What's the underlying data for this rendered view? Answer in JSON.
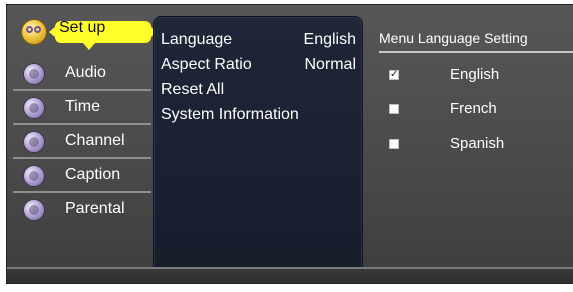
{
  "menu": {
    "items": [
      {
        "label": "Set up",
        "icon": "setup-icon",
        "selected": true
      },
      {
        "label": "Audio",
        "icon": "audio-icon"
      },
      {
        "label": "Time",
        "icon": "time-icon"
      },
      {
        "label": "Channel",
        "icon": "channel-icon"
      },
      {
        "label": "Caption",
        "icon": "caption-icon"
      },
      {
        "label": "Parental",
        "icon": "parental-icon"
      }
    ]
  },
  "center": {
    "rows": [
      {
        "label": "Language",
        "value": "English"
      },
      {
        "label": "Aspect Ratio",
        "value": "Normal"
      },
      {
        "label": "Reset All"
      },
      {
        "label": "System Information"
      }
    ]
  },
  "right": {
    "title": "Menu Language Setting",
    "options": [
      {
        "label": "English",
        "checked": true,
        "mark": "✓"
      },
      {
        "label": "French",
        "checked": false
      },
      {
        "label": "Spanish",
        "checked": false
      }
    ]
  },
  "colors": {
    "highlight": "#ffff2a",
    "panel": "#1e2638",
    "frame": "#575757"
  }
}
